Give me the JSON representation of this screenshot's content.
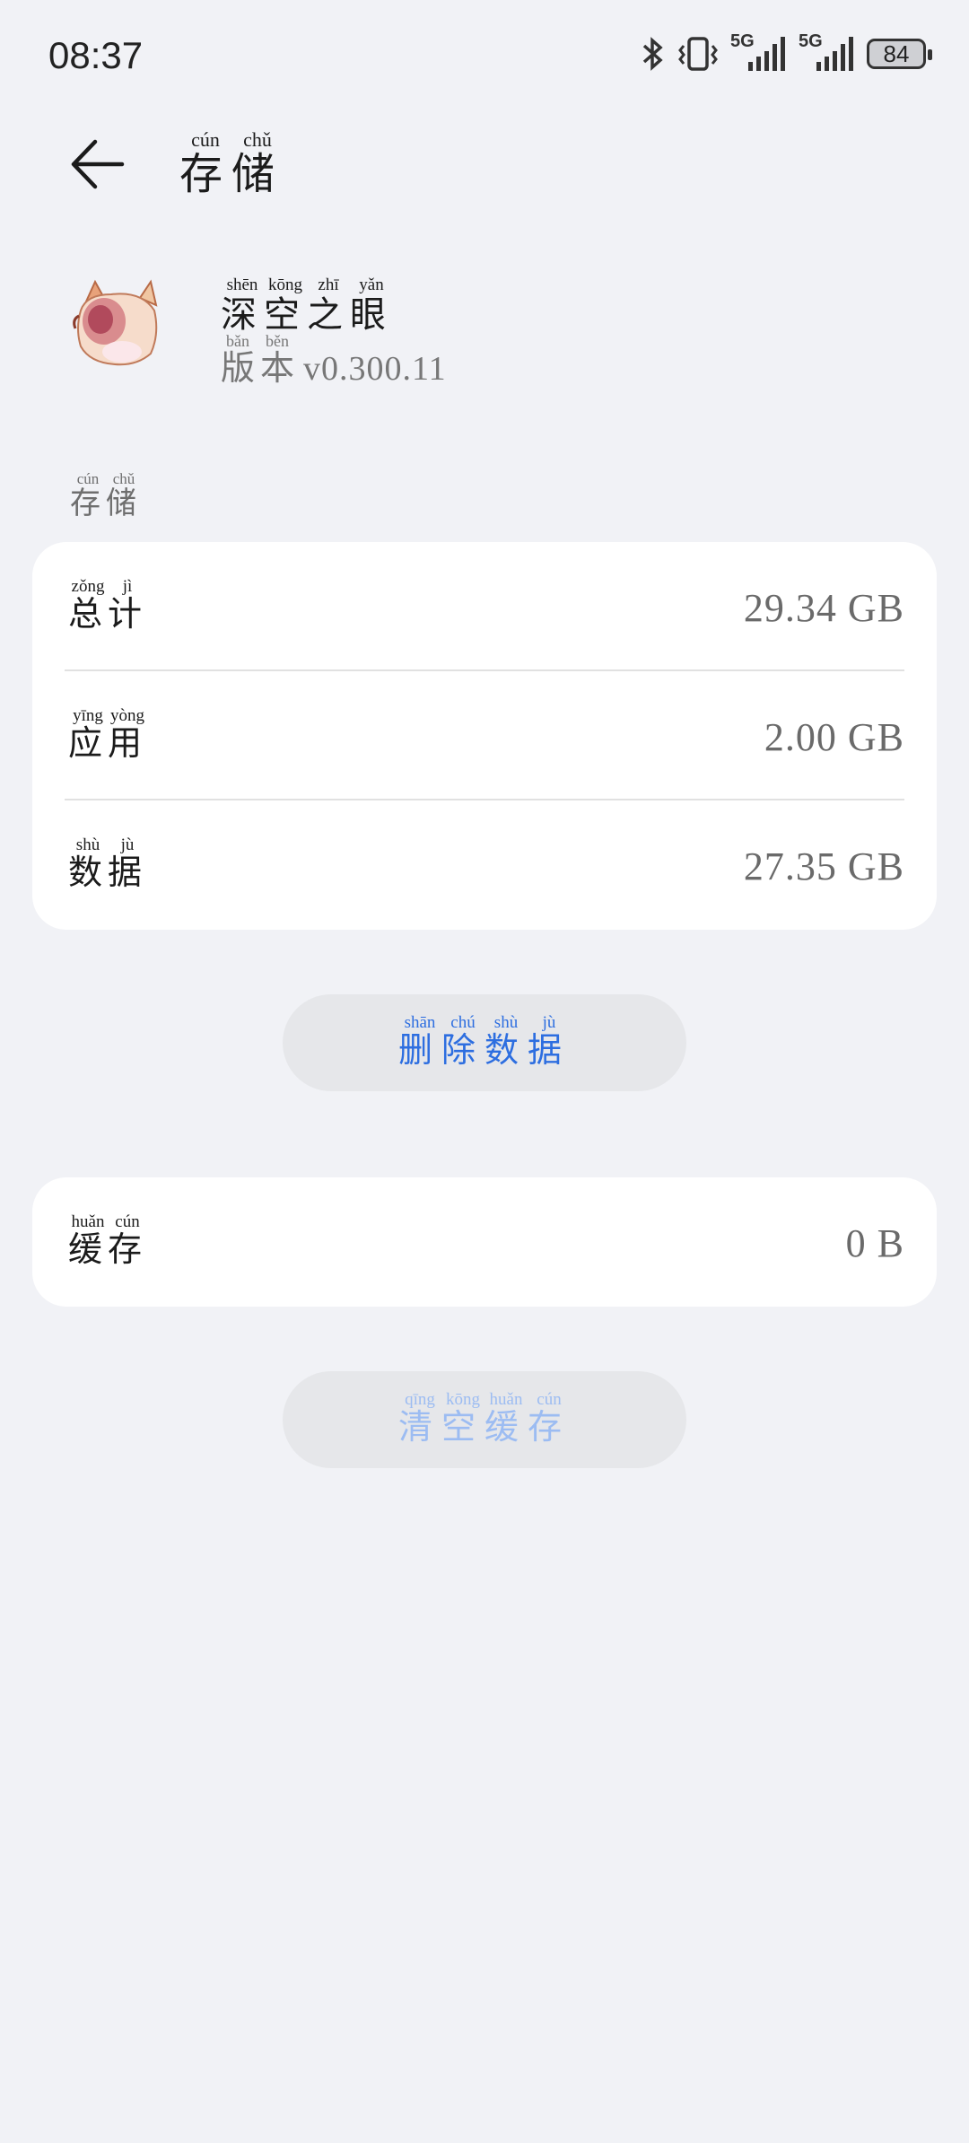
{
  "status_bar": {
    "time": "08:37",
    "battery": "84",
    "network1": "5G",
    "network2": "5G",
    "icons": [
      "bluetooth-icon",
      "vibrate-icon",
      "signal-icon",
      "signal-icon",
      "battery-icon"
    ]
  },
  "header": {
    "title": {
      "chars": [
        "存",
        "储"
      ],
      "pinyin": [
        "cún",
        "chǔ"
      ]
    },
    "back_icon": "arrow-left-icon"
  },
  "app": {
    "name": {
      "chars": [
        "深",
        "空",
        "之",
        "眼"
      ],
      "pinyin": [
        "shēn",
        "kōng",
        "zhī",
        "yǎn"
      ]
    },
    "version_label": {
      "chars": [
        "版",
        "本"
      ],
      "pinyin": [
        "bǎn",
        "běn"
      ]
    },
    "version": "v0.300.11"
  },
  "section": {
    "chars": [
      "存",
      "储"
    ],
    "pinyin": [
      "cún",
      "chǔ"
    ]
  },
  "storage_rows": [
    {
      "label": {
        "chars": [
          "总",
          "计"
        ],
        "pinyin": [
          "zǒng",
          "jì"
        ]
      },
      "value": "29.34 GB"
    },
    {
      "label": {
        "chars": [
          "应",
          "用"
        ],
        "pinyin": [
          "yīng",
          "yòng"
        ]
      },
      "value": "2.00 GB"
    },
    {
      "label": {
        "chars": [
          "数",
          "据"
        ],
        "pinyin": [
          "shù",
          "jù"
        ]
      },
      "value": "27.35 GB"
    }
  ],
  "delete_button": {
    "chars": [
      "删",
      "除",
      "数",
      "据"
    ],
    "pinyin": [
      "shān",
      "chú",
      "shù",
      "jù"
    ]
  },
  "cache": {
    "label": {
      "chars": [
        "缓",
        "存"
      ],
      "pinyin": [
        "huǎn",
        "cún"
      ]
    },
    "value": "0 B"
  },
  "clear_button": {
    "chars": [
      "清",
      "空",
      "缓",
      "存"
    ],
    "pinyin": [
      "qīng",
      "kōng",
      "huǎn",
      "cún"
    ]
  },
  "colors": {
    "accent": "#2d6ee0",
    "accent_disabled": "#9cbcf2",
    "background": "#f1f2f6",
    "card": "#ffffff"
  }
}
